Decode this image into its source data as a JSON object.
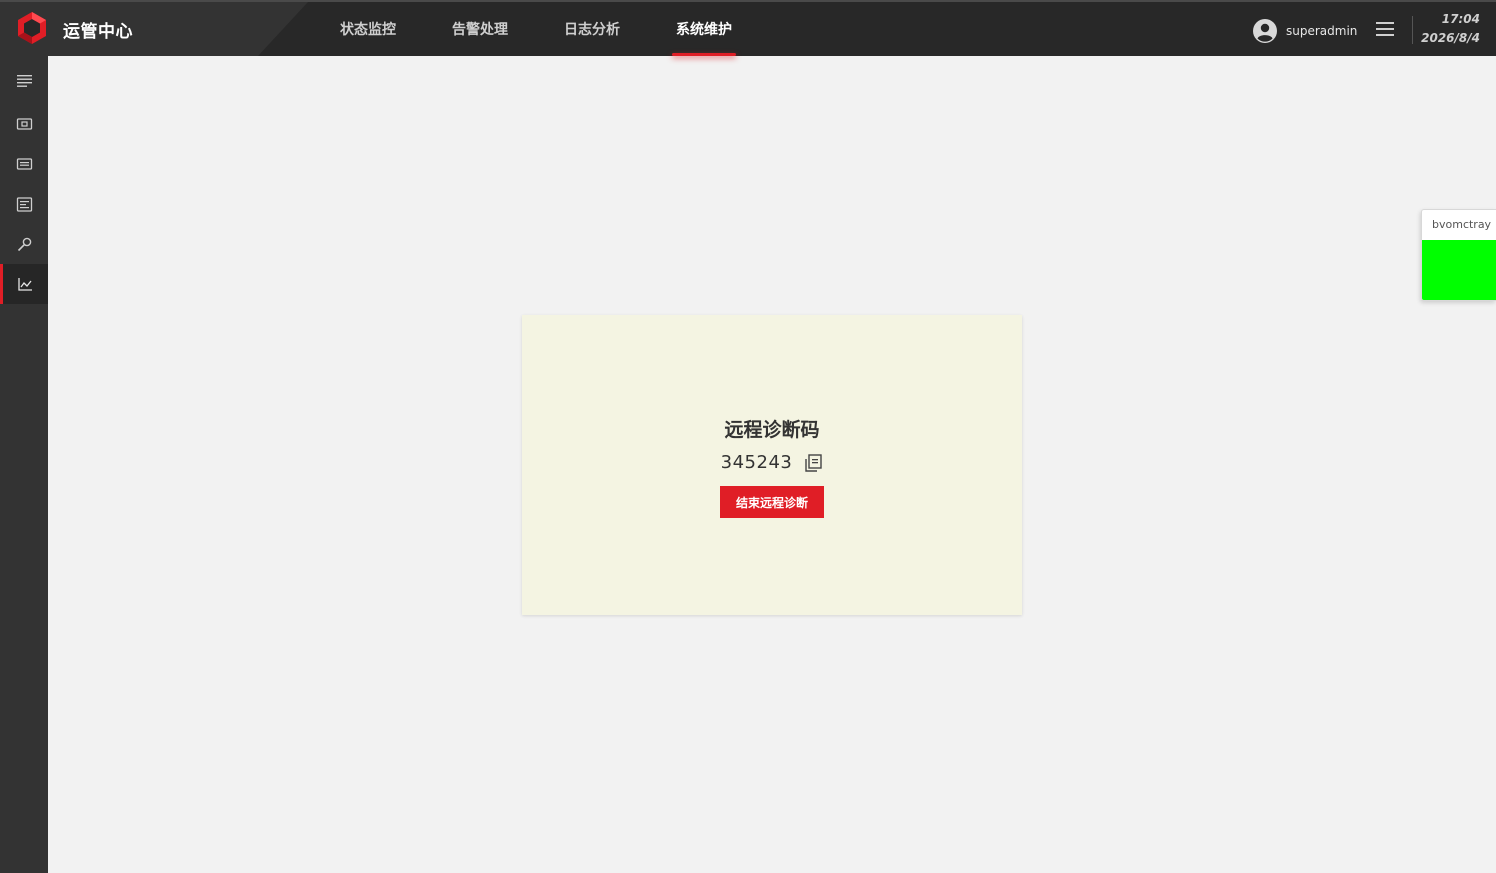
{
  "header": {
    "app_title": "运管中心",
    "nav": [
      {
        "label": "状态监控",
        "active": false
      },
      {
        "label": "告警处理",
        "active": false
      },
      {
        "label": "日志分析",
        "active": false
      },
      {
        "label": "系统维护",
        "active": true
      }
    ],
    "username": "superadmin",
    "time": "17:04",
    "date": "2026/8/4"
  },
  "sidebar": {
    "items": [
      {
        "icon": "menu-lines-icon",
        "active": false
      },
      {
        "icon": "device-screen-icon",
        "active": false
      },
      {
        "icon": "monitor-icon",
        "active": false
      },
      {
        "icon": "document-list-icon",
        "active": false
      },
      {
        "icon": "wrench-icon",
        "active": false
      },
      {
        "icon": "line-chart-icon",
        "active": true
      }
    ]
  },
  "card": {
    "title": "远程诊断码",
    "code": "345243",
    "end_button": "结束远程诊断"
  },
  "tray": {
    "label": "bvomctray",
    "status_color": "#00ff00"
  },
  "colors": {
    "accent": "#e01e26",
    "header_bg": "#282828",
    "sidebar_bg": "#333333",
    "content_bg": "#f2f2f2",
    "card_bg": "#f4f4e2"
  }
}
